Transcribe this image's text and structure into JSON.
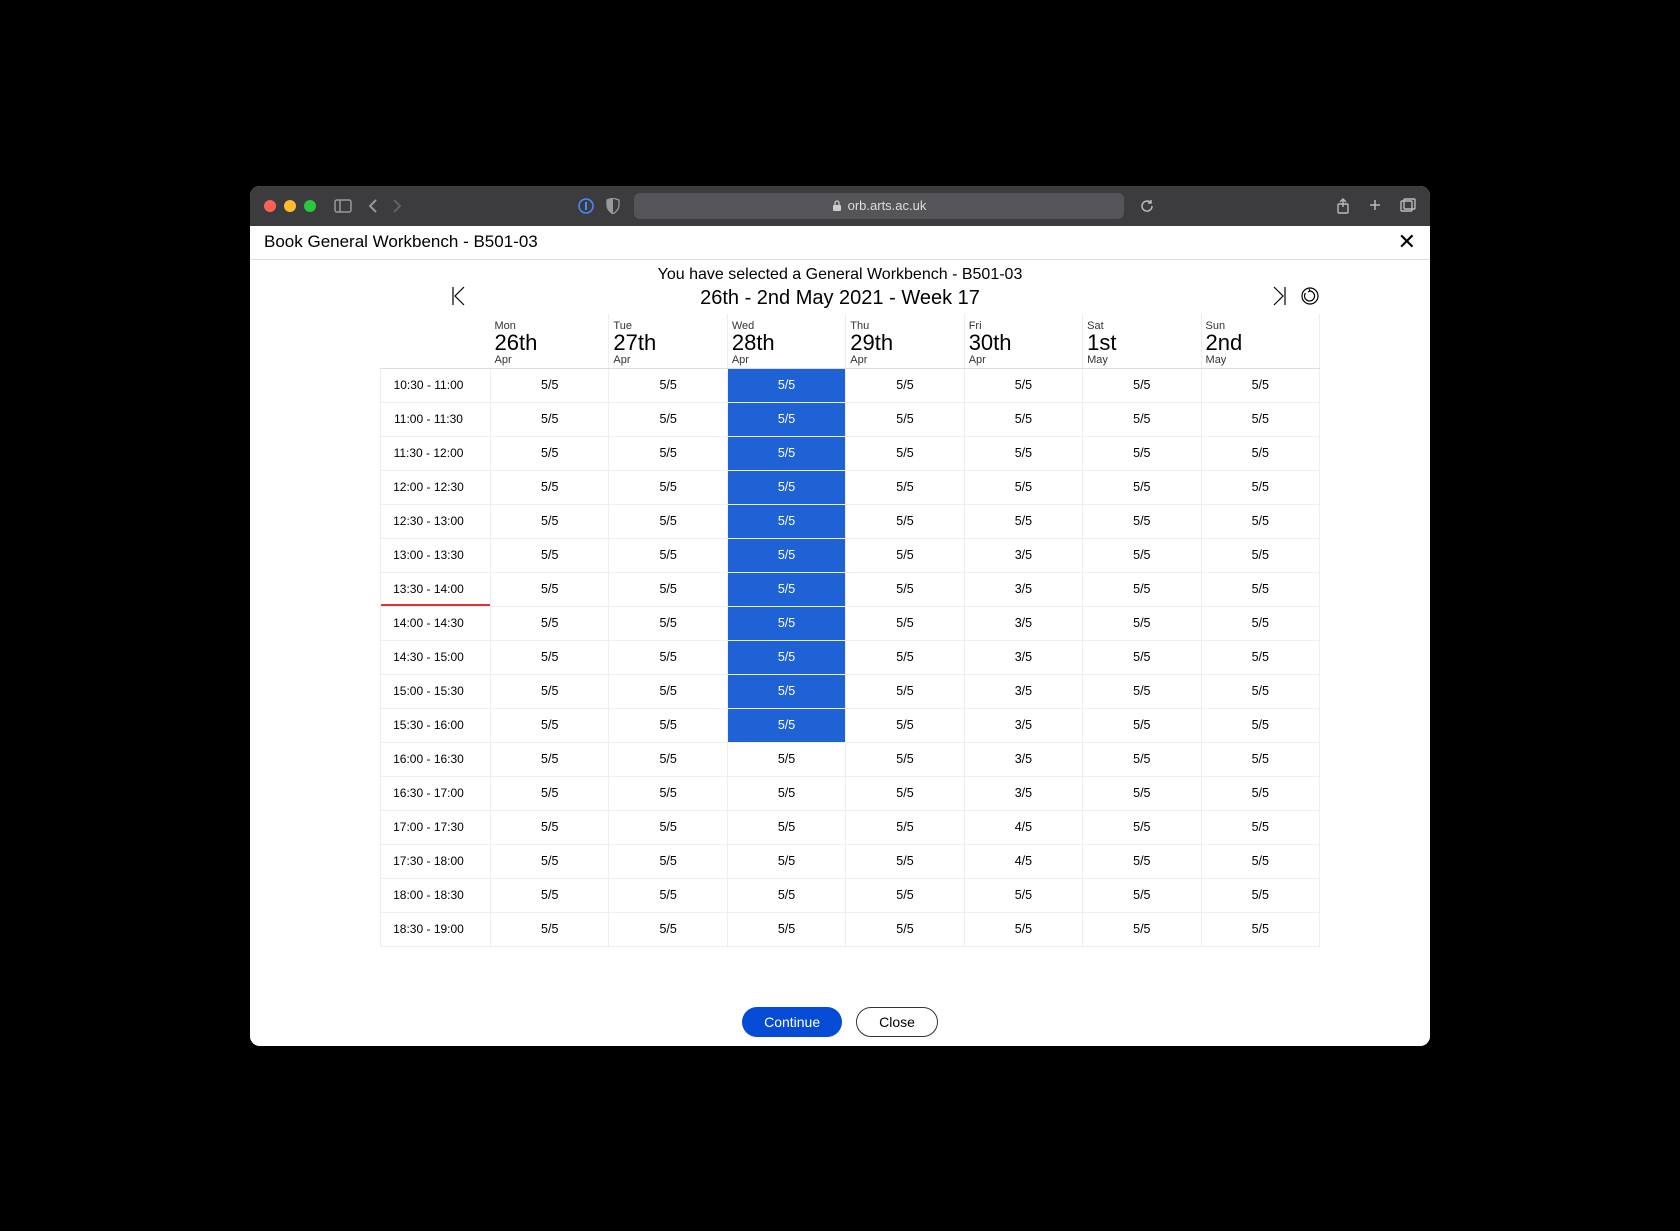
{
  "browser": {
    "url_host": "orb.arts.ac.uk"
  },
  "modal": {
    "title": "Book General Workbench - B501-03",
    "subtitle": "You have selected a General Workbench - B501-03",
    "week_label": "26th - 2nd May 2021 - Week 17",
    "continue": "Continue",
    "close": "Close"
  },
  "days": [
    {
      "dow": "Mon",
      "num": "26th",
      "mon": "Apr"
    },
    {
      "dow": "Tue",
      "num": "27th",
      "mon": "Apr"
    },
    {
      "dow": "Wed",
      "num": "28th",
      "mon": "Apr"
    },
    {
      "dow": "Thu",
      "num": "29th",
      "mon": "Apr"
    },
    {
      "dow": "Fri",
      "num": "30th",
      "mon": "Apr"
    },
    {
      "dow": "Sat",
      "num": "1st",
      "mon": "May"
    },
    {
      "dow": "Sun",
      "num": "2nd",
      "mon": "May"
    }
  ],
  "times": [
    "10:30 - 11:00",
    "11:00 - 11:30",
    "11:30 - 12:00",
    "12:00 - 12:30",
    "12:30 - 13:00",
    "13:00 - 13:30",
    "13:30 - 14:00",
    "14:00 - 14:30",
    "14:30 - 15:00",
    "15:00 - 15:30",
    "15:30 - 16:00",
    "16:00 - 16:30",
    "16:30 - 17:00",
    "17:00 - 17:30",
    "17:30 - 18:00",
    "18:00 - 18:30",
    "18:30 - 19:00"
  ],
  "slots": [
    [
      "5/5",
      "5/5",
      "5/5",
      "5/5",
      "5/5",
      "5/5",
      "5/5"
    ],
    [
      "5/5",
      "5/5",
      "5/5",
      "5/5",
      "5/5",
      "5/5",
      "5/5"
    ],
    [
      "5/5",
      "5/5",
      "5/5",
      "5/5",
      "5/5",
      "5/5",
      "5/5"
    ],
    [
      "5/5",
      "5/5",
      "5/5",
      "5/5",
      "5/5",
      "5/5",
      "5/5"
    ],
    [
      "5/5",
      "5/5",
      "5/5",
      "5/5",
      "5/5",
      "5/5",
      "5/5"
    ],
    [
      "5/5",
      "5/5",
      "5/5",
      "5/5",
      "3/5",
      "5/5",
      "5/5"
    ],
    [
      "5/5",
      "5/5",
      "5/5",
      "5/5",
      "3/5",
      "5/5",
      "5/5"
    ],
    [
      "5/5",
      "5/5",
      "5/5",
      "5/5",
      "3/5",
      "5/5",
      "5/5"
    ],
    [
      "5/5",
      "5/5",
      "5/5",
      "5/5",
      "3/5",
      "5/5",
      "5/5"
    ],
    [
      "5/5",
      "5/5",
      "5/5",
      "5/5",
      "3/5",
      "5/5",
      "5/5"
    ],
    [
      "5/5",
      "5/5",
      "5/5",
      "5/5",
      "3/5",
      "5/5",
      "5/5"
    ],
    [
      "5/5",
      "5/5",
      "5/5",
      "5/5",
      "3/5",
      "5/5",
      "5/5"
    ],
    [
      "5/5",
      "5/5",
      "5/5",
      "5/5",
      "3/5",
      "5/5",
      "5/5"
    ],
    [
      "5/5",
      "5/5",
      "5/5",
      "5/5",
      "4/5",
      "5/5",
      "5/5"
    ],
    [
      "5/5",
      "5/5",
      "5/5",
      "5/5",
      "4/5",
      "5/5",
      "5/5"
    ],
    [
      "5/5",
      "5/5",
      "5/5",
      "5/5",
      "5/5",
      "5/5",
      "5/5"
    ],
    [
      "5/5",
      "5/5",
      "5/5",
      "5/5",
      "5/5",
      "5/5",
      "5/5"
    ]
  ],
  "selected": {
    "day": 2,
    "from": 0,
    "to": 10
  },
  "now_row": 6
}
